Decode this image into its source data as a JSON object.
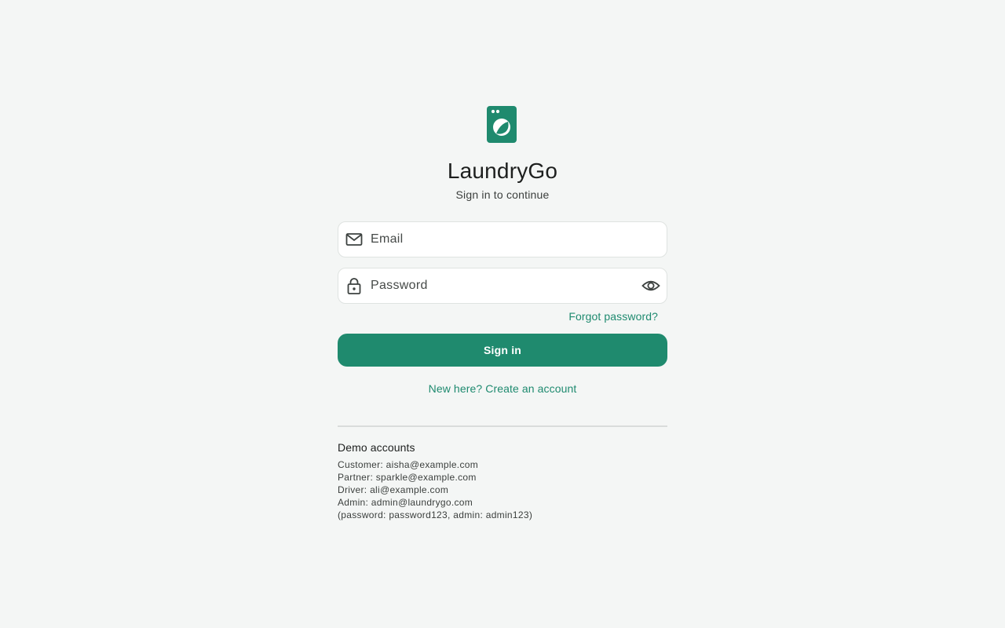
{
  "app": {
    "name": "LaundryGo",
    "subtitle": "Sign in to continue",
    "logo_icon": "washing-machine-icon",
    "accent_color": "#1f8a6e"
  },
  "form": {
    "email": {
      "placeholder": "Email",
      "value": "",
      "icon": "mail-icon"
    },
    "password": {
      "placeholder": "Password",
      "value": "",
      "icon": "lock-icon",
      "toggle_icon": "eye-icon"
    },
    "forgot_label": "Forgot password?",
    "submit_label": "Sign in",
    "create_account_label": "New here? Create an account"
  },
  "demo": {
    "title": "Demo accounts",
    "lines": [
      "Customer: aisha@example.com",
      "Partner: sparkle@example.com",
      "Driver: ali@example.com",
      "Admin: admin@laundrygo.com",
      "(password: password123, admin: admin123)"
    ]
  }
}
